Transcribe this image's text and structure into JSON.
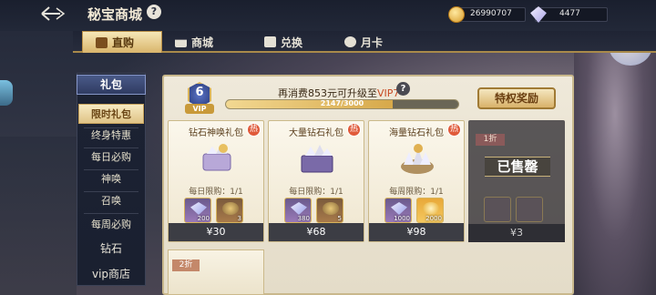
{
  "header": {
    "title": "秘宝商城",
    "help_label": "?"
  },
  "currency": [
    {
      "icon": "gold-coin-icon",
      "value": "26990707"
    },
    {
      "icon": "diamond-icon",
      "value": "4477"
    }
  ],
  "tabs": [
    {
      "label": "直购",
      "icon": "gift-icon",
      "active": true
    },
    {
      "label": "商城",
      "icon": "shop-icon",
      "active": false
    },
    {
      "label": "兑换",
      "icon": "exchange-icon",
      "active": false
    },
    {
      "label": "月卡",
      "icon": "card-icon",
      "active": false
    }
  ],
  "sidebar": {
    "header": "礼包",
    "items": [
      "限时礼包",
      "终身特惠",
      "每日必购",
      "神唤",
      "召唤",
      "每周必购"
    ],
    "active_index": 0,
    "categories": [
      "钻石",
      "vip商店"
    ]
  },
  "vip": {
    "level": "6",
    "label": "VIP",
    "upgrade_prefix": "再消费",
    "upgrade_amount": "853",
    "upgrade_middle": "元可升级至",
    "upgrade_target": "VIP7",
    "progress_text": "2147/3000",
    "progress_fraction": 0.716,
    "privilege_button": "特权奖励"
  },
  "packs": [
    {
      "name": "钻石神唤礼包",
      "hot": "热",
      "limit": "每日限购：1/1",
      "items": [
        "200",
        "3"
      ],
      "price": "¥30"
    },
    {
      "name": "大量钻石礼包",
      "hot": "热",
      "limit": "每日限购：1/1",
      "items": [
        "380",
        "5"
      ],
      "price": "¥68"
    },
    {
      "name": "海量钻石礼包",
      "hot": "热",
      "limit": "每周限购：1/1",
      "items": [
        "1000",
        "2000"
      ],
      "price": "¥98"
    }
  ],
  "sold_out_pack": {
    "discount": "1折",
    "stamp": "已售罄",
    "price": "¥3"
  },
  "next_row": {
    "discount": "2折"
  },
  "colors": {
    "accent_gold": "#d9b56b",
    "highlight_red": "#c84a22",
    "price_bar": "#3c3d44"
  }
}
